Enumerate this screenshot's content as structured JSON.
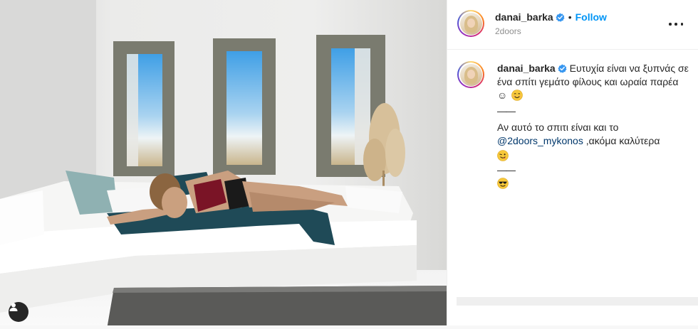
{
  "post": {
    "author": "danai_barka",
    "location": "2doors",
    "follow_label": "Follow",
    "separator": "•"
  },
  "caption": {
    "username": "danai_barka",
    "line1": "Ευτυχία είναι να ξυπνάς σε ένα σπίτι γεμάτο φίλους και ωραία παρέα ☺",
    "divider1": "——",
    "line2_prefix": "Αν αυτό το σπιτι είναι και το ",
    "mention": "@2doors_mykonos",
    "line2_suffix": " ,ακόμα καλύτερα",
    "divider2": "——"
  },
  "icons": {
    "verified": "verified-badge-icon",
    "more": "more-options-icon",
    "user_tag": "user-tag-icon",
    "emoji_smile": "smiling-face-icon",
    "emoji_yum": "yum-face-icon",
    "emoji_sunglasses": "sunglasses-face-icon"
  },
  "colors": {
    "link_blue": "#0095f6",
    "mention": "#00376b",
    "verified": "#3897f0",
    "text": "#262626",
    "muted": "#8e8e8e"
  }
}
